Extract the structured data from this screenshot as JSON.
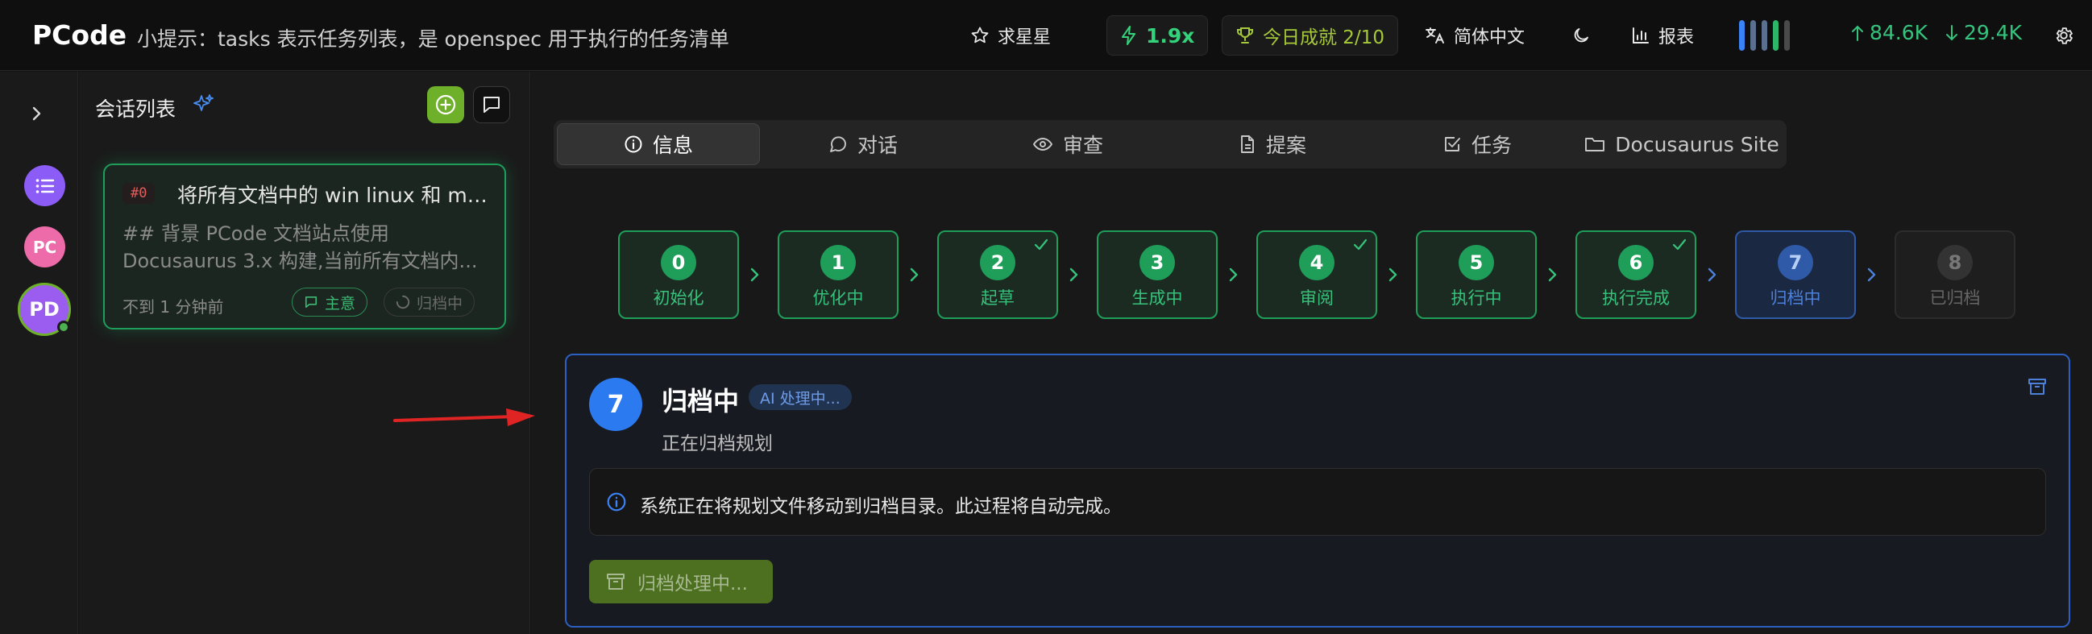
{
  "topbar": {
    "brand": "PCode",
    "tip": "小提示：tasks 表示任务列表，是 openspec 用于执行的任务清单",
    "star_label": "求星星",
    "speed": "1.9x",
    "achievement": "今日成就 2/10",
    "language": "简体中文",
    "report_label": "报表",
    "upload": "84.6K",
    "download": "29.4K",
    "colors": {
      "accent_green": "#34d27a",
      "bar_blue": "#3b82f6"
    }
  },
  "rail": {
    "avatars": [
      {
        "text": "",
        "color": "#8b5cf6"
      },
      {
        "text": "PC",
        "color": "#ec6ba8"
      },
      {
        "text": "PD",
        "color": "#9b5cf0"
      }
    ]
  },
  "sessions": {
    "title": "会话列表",
    "card": {
      "id": "#0",
      "title": "将所有文档中的 win linux 和 ma...",
      "desc_line1": "## 背景 PCode 文档站点使用",
      "desc_line2": "Docusaurus 3.x 构建,当前所有文档内...",
      "time": "不到 1 分钟前",
      "tag_main": "主意",
      "tag_archive": "归档中"
    }
  },
  "tabs": [
    {
      "label": "信息",
      "icon": "info-icon"
    },
    {
      "label": "对话",
      "icon": "chat-icon"
    },
    {
      "label": "审查",
      "icon": "eye-icon"
    },
    {
      "label": "提案",
      "icon": "document-icon"
    },
    {
      "label": "任务",
      "icon": "checkbox-icon"
    },
    {
      "label": "Docusaurus Site",
      "icon": "folder-icon"
    }
  ],
  "steps": [
    {
      "num": "0",
      "label": "初始化",
      "state": "done",
      "check": false
    },
    {
      "num": "1",
      "label": "优化中",
      "state": "done",
      "check": false
    },
    {
      "num": "2",
      "label": "起草",
      "state": "done",
      "check": true
    },
    {
      "num": "3",
      "label": "生成中",
      "state": "done",
      "check": false
    },
    {
      "num": "4",
      "label": "审阅",
      "state": "done",
      "check": true
    },
    {
      "num": "5",
      "label": "执行中",
      "state": "done",
      "check": false
    },
    {
      "num": "6",
      "label": "执行完成",
      "state": "done",
      "check": true
    },
    {
      "num": "7",
      "label": "归档中",
      "state": "current",
      "check": false
    },
    {
      "num": "8",
      "label": "已归档",
      "state": "pending",
      "check": false
    }
  ],
  "panel": {
    "num": "7",
    "title": "归档中",
    "badge": "AI 处理中...",
    "subtitle": "正在归档规划",
    "info": "系统正在将规划文件移动到归档目录。此过程将自动完成。",
    "button": "归档处理中..."
  }
}
